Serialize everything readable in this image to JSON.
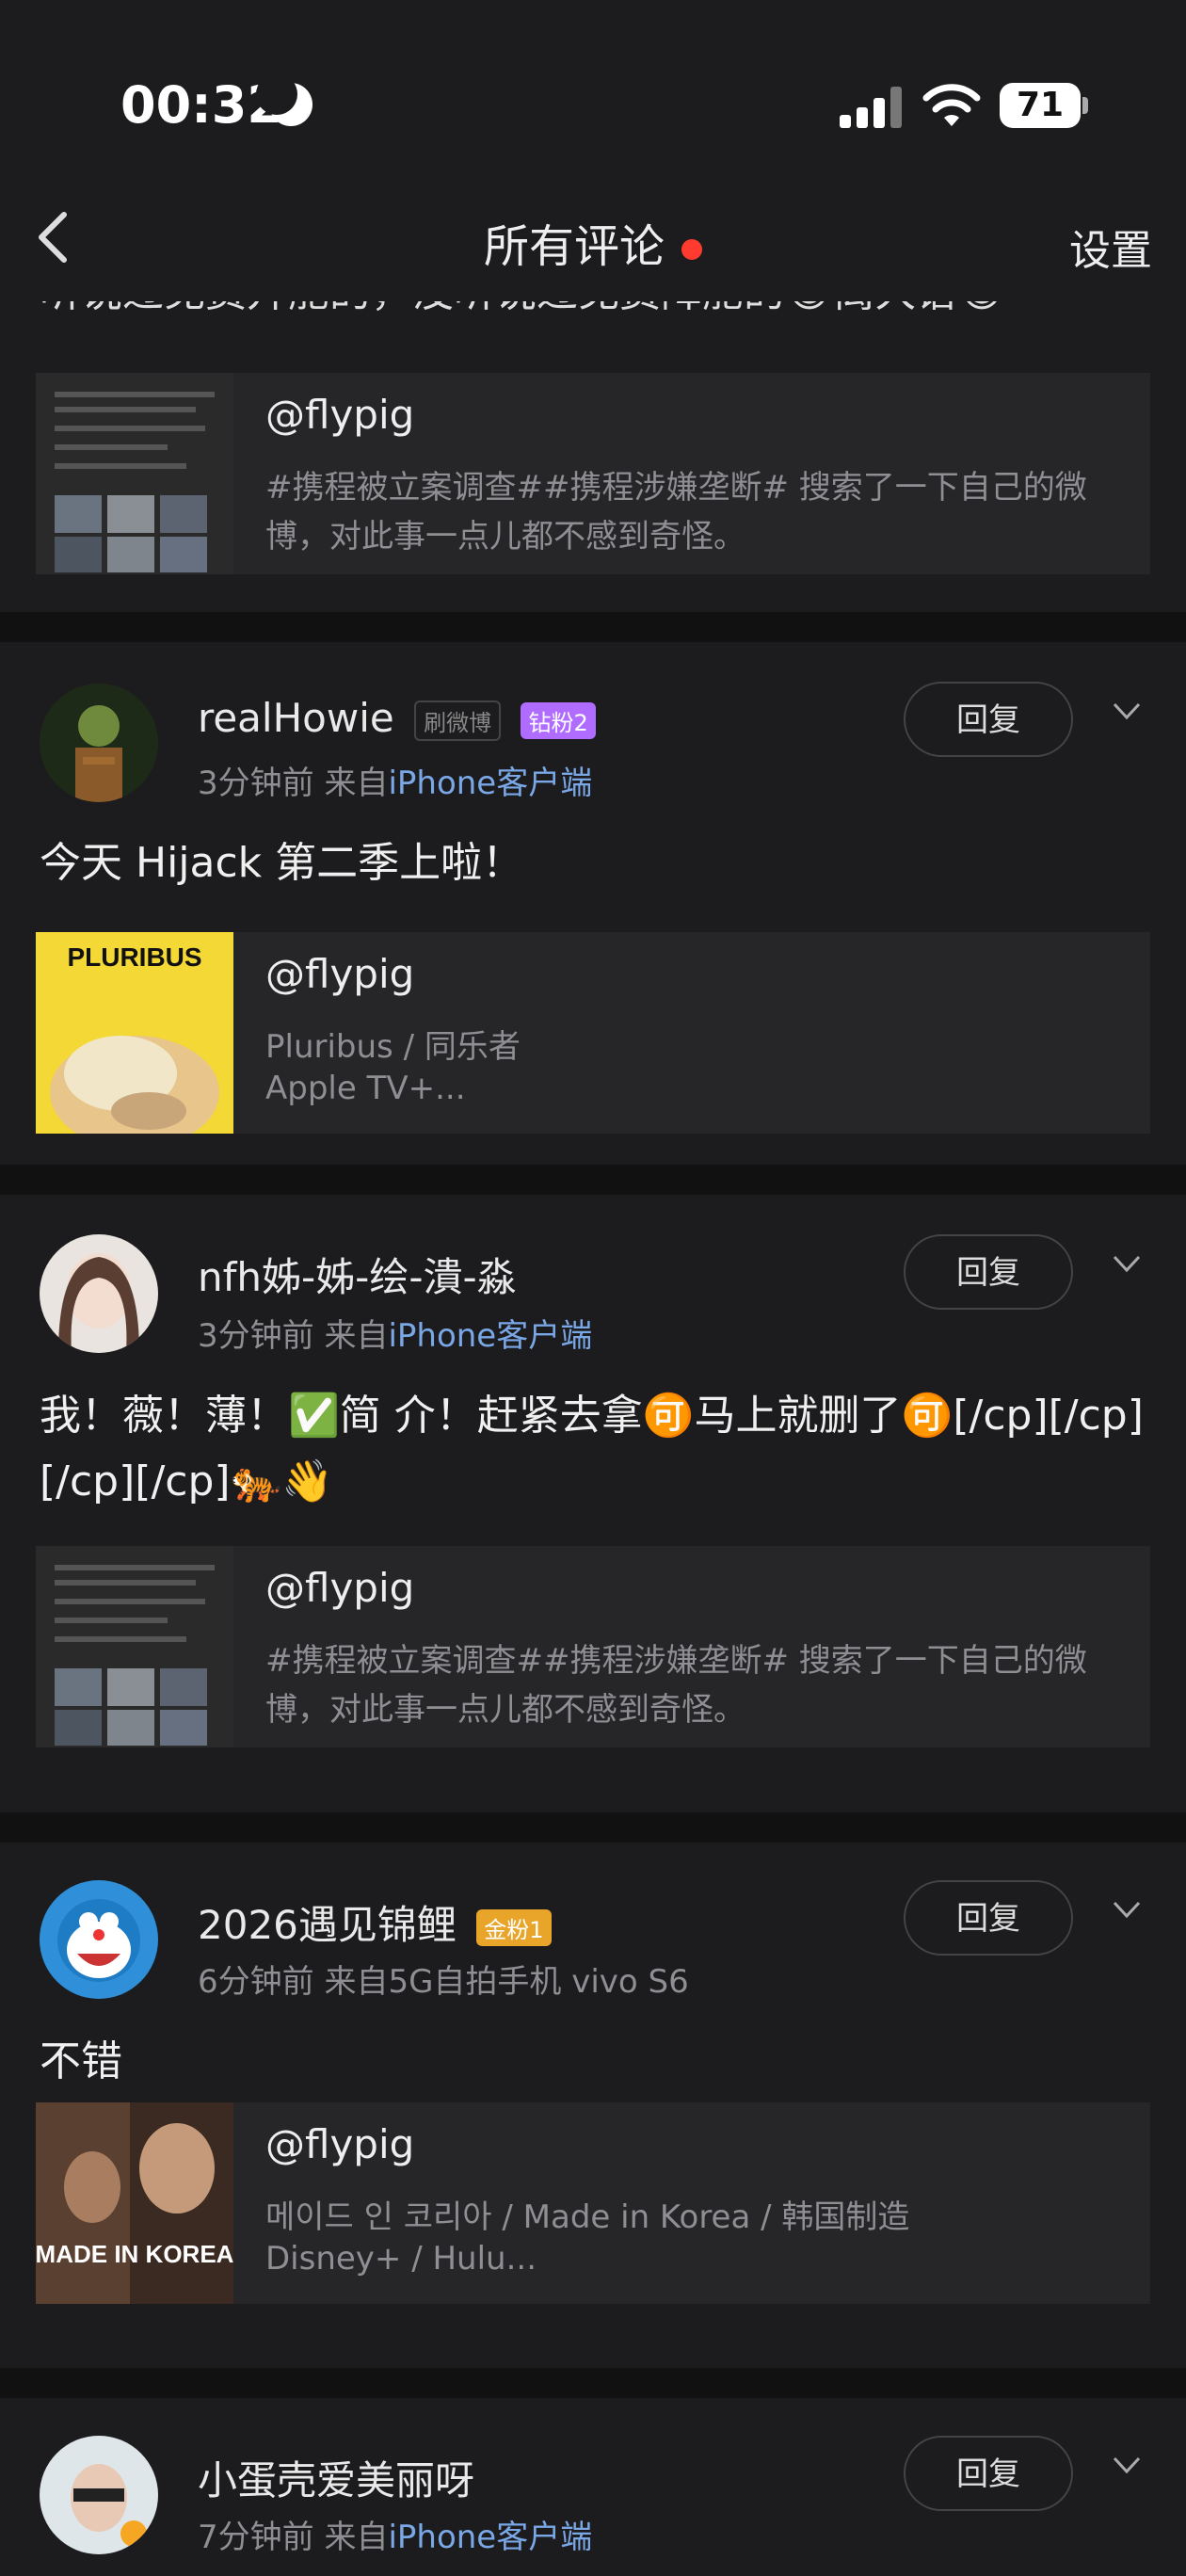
{
  "status": {
    "time": "00:32",
    "battery": "71"
  },
  "nav": {
    "title": "所有评论",
    "settings": "设置"
  },
  "partial_comment": "听说过免费升舱的，没听说过免费降舱的😂离大谱😂",
  "share_default": {
    "author": "@flypig",
    "line1": "#携程被立案调查##携程涉嫌垄断# 搜索了一下自己的微",
    "line2": "博，对此事一点儿都不感到奇怪。"
  },
  "comments": [
    {
      "username": "realHowie",
      "badge_weibo": "刷微博",
      "badge_vip": "钻粉2",
      "time": "3分钟前",
      "from": "来自",
      "source": "iPhone客户端",
      "reply": "回复",
      "text": "今天 Hijack 第二季上啦！",
      "share": {
        "author": "@flypig",
        "line1": "Pluribus / 同乐者",
        "line2": "Apple TV+...",
        "thumb_text": "PLURIBUS"
      }
    },
    {
      "username": "nfh姊-姊-绘-潰-淼",
      "time": "3分钟前",
      "from": "来自",
      "source": "iPhone客户端",
      "reply": "回复",
      "text": "我！薇！薄！✅简 介！赶紧去拿🉑马上就删了🉑[/cp][/cp][/cp][/cp]🐅👋",
      "share": {
        "author": "@flypig",
        "line1": "#携程被立案调查##携程涉嫌垄断# 搜索了一下自己的微",
        "line2": "博，对此事一点儿都不感到奇怪。"
      }
    },
    {
      "username": "2026遇见锦鲤",
      "badge_gold": "金粉1",
      "time": "6分钟前",
      "from": "来自",
      "source_plain": "5G自拍手机 vivo S6",
      "reply": "回复",
      "text": "不错",
      "share": {
        "author": "@flypig",
        "line1": "메이드 인 코리아 / Made in Korea / 韩国制造",
        "line2": "Disney+ / Hulu...",
        "thumb_text": "MADE IN KOREA"
      }
    },
    {
      "username": "小蛋壳爱美丽呀",
      "time": "7分钟前",
      "from": "来自",
      "source": "iPhone客户端",
      "reply": "回复"
    }
  ]
}
